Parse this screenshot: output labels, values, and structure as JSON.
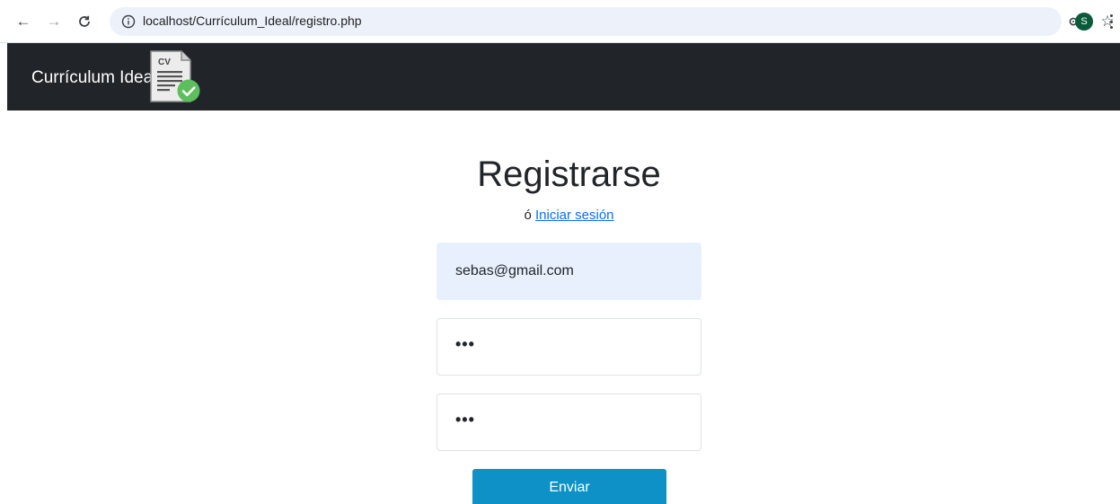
{
  "browser": {
    "url": "localhost/Currículum_Ideal/registro.php",
    "avatar_initial": "S",
    "icons": {
      "back": "arrow-left-icon",
      "forward": "arrow-right-icon",
      "reload": "reload-icon",
      "site_info": "info-icon",
      "password_key": "key-icon",
      "bookmark": "star-icon",
      "menu": "kebab-menu-icon"
    }
  },
  "navbar": {
    "brand": "Currículum Ideal",
    "logo_text": "CV",
    "background": "#212529"
  },
  "form": {
    "title": "Registrarse",
    "subtitle_prefix": "ó",
    "login_link": "Iniciar sesión",
    "email_value": "sebas@gmail.com",
    "password_value": "•••",
    "password_confirm_value": "•••",
    "submit_label": "Enviar",
    "accent_color": "#0d91c6",
    "link_color": "#0d6efd"
  }
}
